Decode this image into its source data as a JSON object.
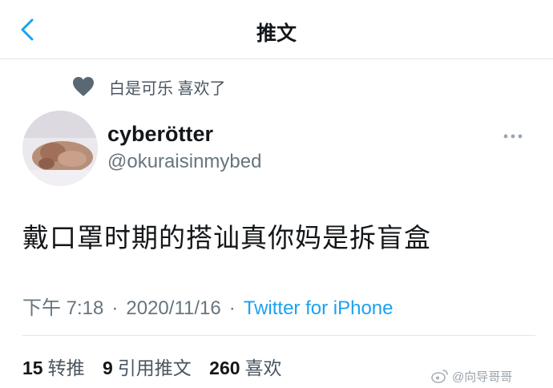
{
  "header": {
    "title": "推文",
    "back_icon": "chevron-left-icon"
  },
  "liked_by": {
    "text": "白是可乐 喜欢了",
    "icon": "heart-icon"
  },
  "author": {
    "display_name": "cyberötter",
    "handle": "@okuraisinmybed"
  },
  "tweet": {
    "text": "戴口罩时期的搭讪真你妈是拆盲盒"
  },
  "meta": {
    "time": "下午 7:18",
    "separator": "·",
    "date": "2020/11/16",
    "source": "Twitter for iPhone"
  },
  "stats": {
    "retweets": {
      "count": "15",
      "label": "转推"
    },
    "quotes": {
      "count": "9",
      "label": "引用推文"
    },
    "likes": {
      "count": "260",
      "label": "喜欢"
    }
  },
  "watermark": {
    "text": "@向导哥哥"
  },
  "colors": {
    "accent": "#1da1f2",
    "secondary_text": "#66757f",
    "primary_text": "#14171a"
  }
}
